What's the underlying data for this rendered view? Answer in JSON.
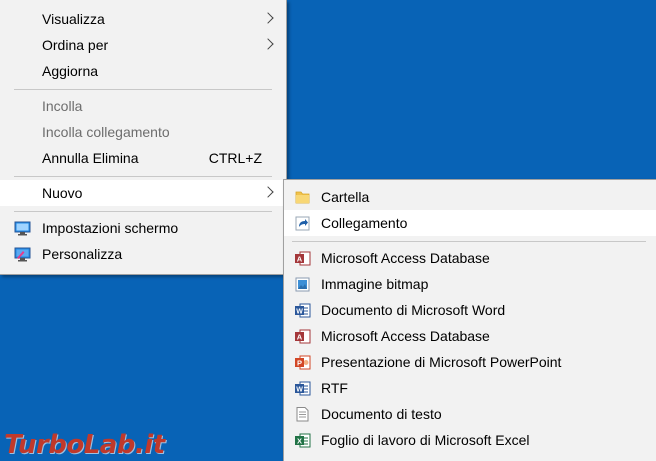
{
  "main_menu": {
    "visualizza": "Visualizza",
    "ordina_per": "Ordina per",
    "aggiorna": "Aggiorna",
    "incolla": "Incolla",
    "incolla_collegamento": "Incolla collegamento",
    "annulla_elimina": "Annulla Elimina",
    "annulla_elimina_shortcut": "CTRL+Z",
    "nuovo": "Nuovo",
    "impostazioni_schermo": "Impostazioni schermo",
    "personalizza": "Personalizza"
  },
  "sub_menu": {
    "items": [
      {
        "label": "Cartella",
        "icon": "folder-icon"
      },
      {
        "label": "Collegamento",
        "icon": "shortcut-icon"
      },
      {
        "label": "Microsoft Access Database",
        "icon": "access-icon"
      },
      {
        "label": "Immagine bitmap",
        "icon": "bitmap-icon"
      },
      {
        "label": "Documento di Microsoft Word",
        "icon": "word-icon"
      },
      {
        "label": "Microsoft Access Database",
        "icon": "access-icon"
      },
      {
        "label": "Presentazione di Microsoft PowerPoint",
        "icon": "powerpoint-icon"
      },
      {
        "label": "RTF",
        "icon": "word-icon"
      },
      {
        "label": "Documento di testo",
        "icon": "text-document-icon"
      },
      {
        "label": "Foglio di lavoro di Microsoft Excel",
        "icon": "excel-icon"
      }
    ]
  },
  "watermark": "TurboLab.it",
  "colors": {
    "desktop": "#0863b6",
    "menu_bg": "#f2f2f2",
    "highlight": "#ffffff",
    "disabled_text": "#6d6d6d"
  }
}
